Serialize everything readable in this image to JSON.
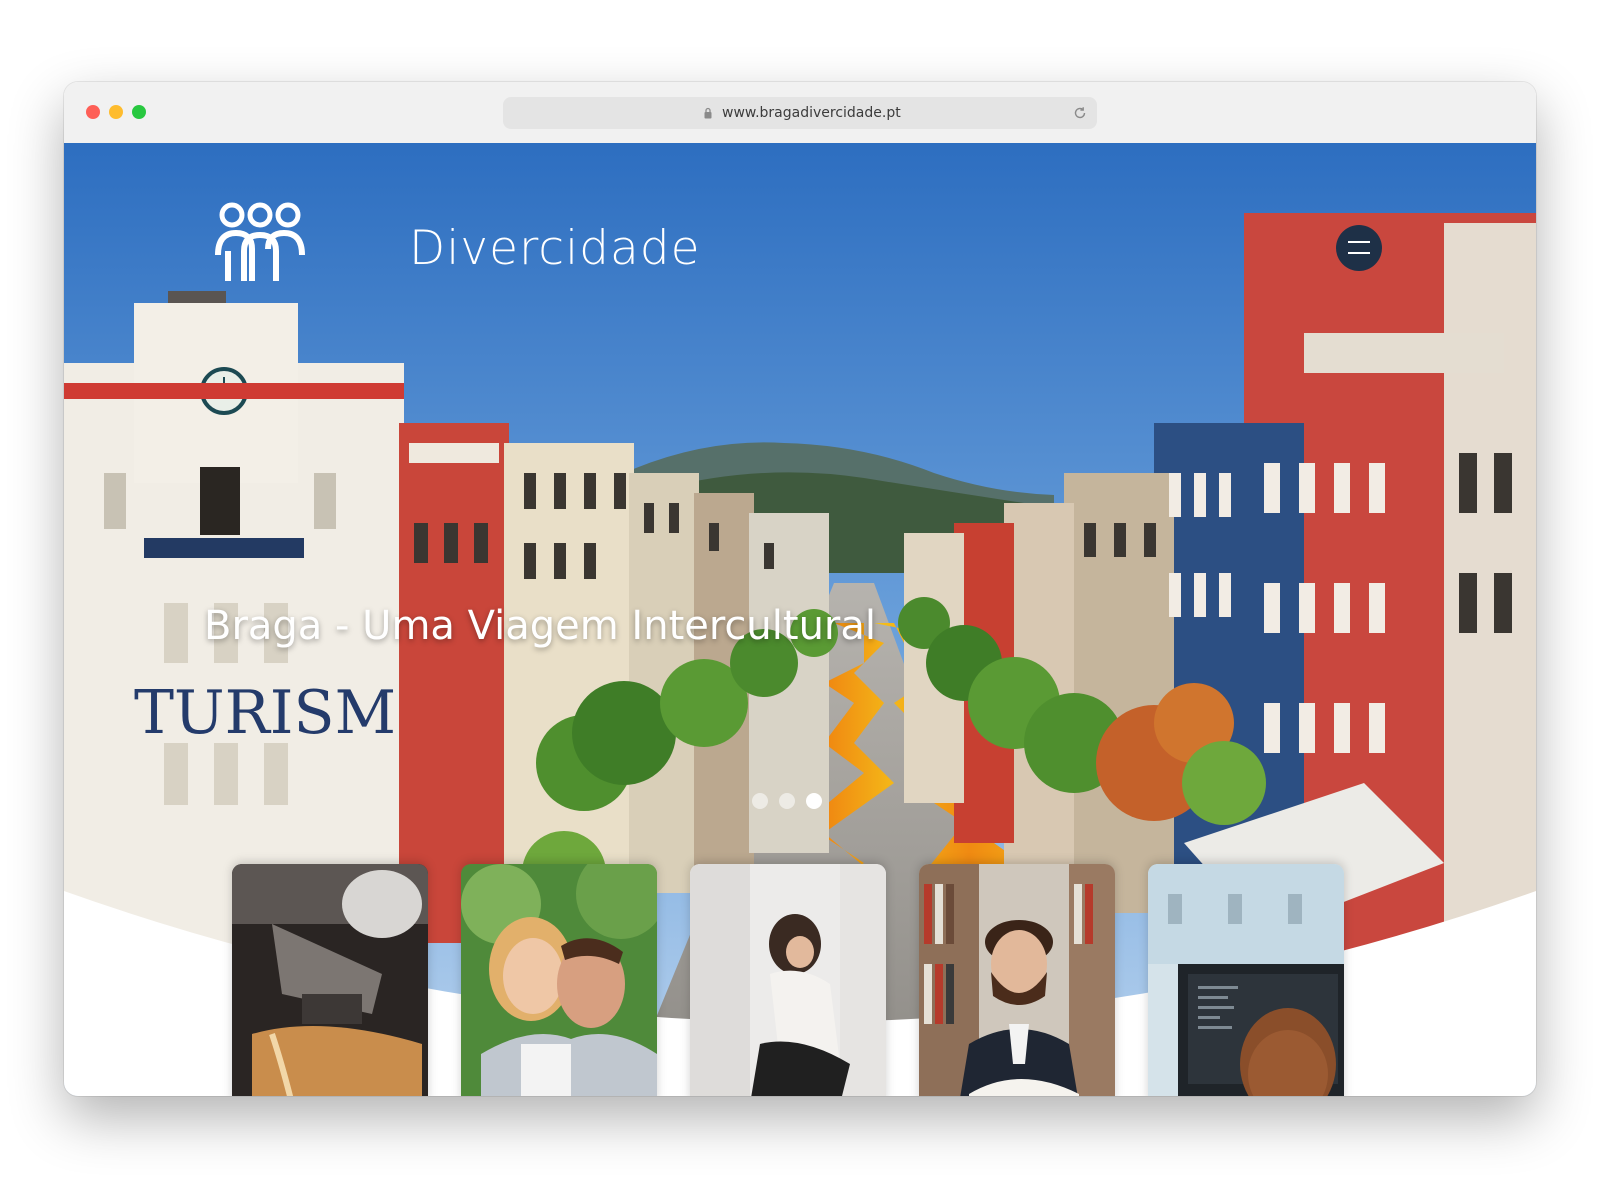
{
  "browser": {
    "url": "www.bragadivercidade.pt",
    "lock_icon": "lock-icon",
    "reload_icon": "reload-icon"
  },
  "header": {
    "logo_text": "Divercidade",
    "logo_icon": "three-people-logo",
    "menu_icon": "hamburger-menu-icon"
  },
  "hero": {
    "title": "Braga - Uma Viagem Intercultural",
    "slides_total": 3,
    "active_slide": 3
  },
  "cards": [
    {
      "subject": "espresso-machine-image"
    },
    {
      "subject": "smiling-couple-image"
    },
    {
      "subject": "woman-sitting-image"
    },
    {
      "subject": "bearded-man-reading-image"
    },
    {
      "subject": "person-at-computer-image"
    }
  ],
  "colors": {
    "menu_button": "#1e3047",
    "sky": "#3a78c4",
    "flowers": "#f0a018"
  }
}
